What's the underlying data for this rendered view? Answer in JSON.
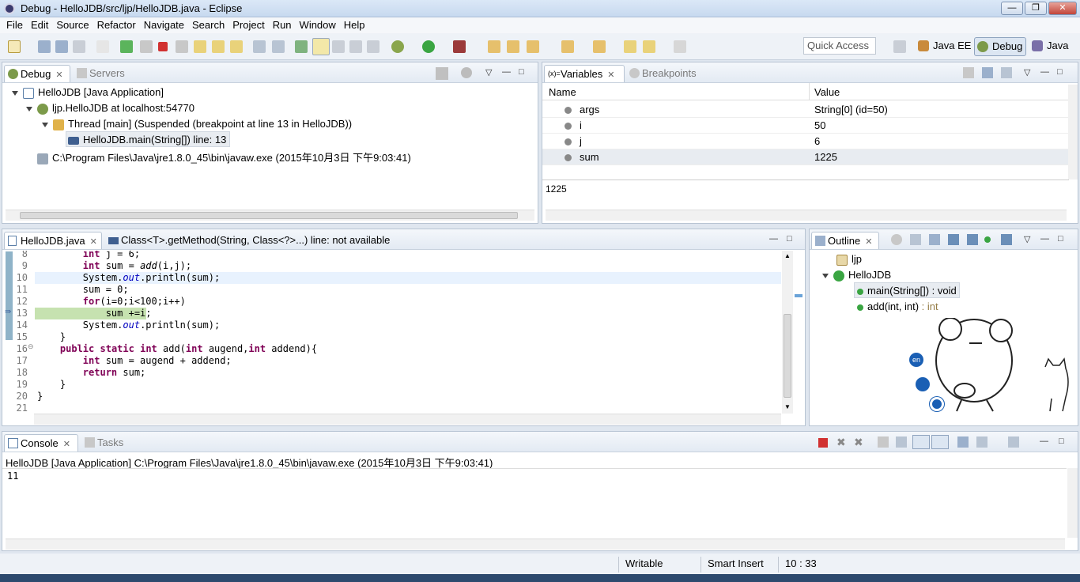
{
  "window": {
    "title": "Debug - HelloJDB/src/ljp/HelloJDB.java - Eclipse"
  },
  "menu": [
    "File",
    "Edit",
    "Source",
    "Refactor",
    "Navigate",
    "Search",
    "Project",
    "Run",
    "Window",
    "Help"
  ],
  "toolbar": {
    "quick_access": "Quick Access"
  },
  "perspectives": {
    "java_ee": "Java EE",
    "debug": "Debug",
    "java": "Java"
  },
  "debug_view": {
    "tab_debug": "Debug",
    "tab_servers": "Servers",
    "tree": {
      "app": "HelloJDB [Java Application]",
      "target": "ljp.HelloJDB at localhost:54770",
      "thread": "Thread [main] (Suspended (breakpoint at line 13 in HelloJDB))",
      "frame": "HelloJDB.main(String[]) line: 13",
      "process": "C:\\Program Files\\Java\\jre1.8.0_45\\bin\\javaw.exe (2015年10月3日 下午9:03:41)"
    }
  },
  "variables_view": {
    "tab_variables": "Variables",
    "tab_breakpoints": "Breakpoints",
    "col_name": "Name",
    "col_value": "Value",
    "rows": [
      {
        "name": "args",
        "value": "String[0]  (id=50)"
      },
      {
        "name": "i",
        "value": "50"
      },
      {
        "name": "j",
        "value": "6"
      },
      {
        "name": "sum",
        "value": "1225"
      }
    ],
    "detail": "1225"
  },
  "editor": {
    "tab_file": "HelloJDB.java",
    "tab_other": "Class<T>.getMethod(String, Class<?>...) line: not available",
    "lines": [
      {
        "n": "8",
        "t": "        int j = 6;"
      },
      {
        "n": "9",
        "t": "        int sum = add(i,j);"
      },
      {
        "n": "10",
        "t": "        System.out.println(sum);"
      },
      {
        "n": "11",
        "t": "        sum = 0;"
      },
      {
        "n": "12",
        "t": "        for(i=0;i<100;i++)"
      },
      {
        "n": "13",
        "t": "            sum +=i;"
      },
      {
        "n": "14",
        "t": "        System.out.println(sum);"
      },
      {
        "n": "15",
        "t": "    }"
      },
      {
        "n": "16",
        "t": "    public static int add(int augend,int addend){"
      },
      {
        "n": "17",
        "t": "        int sum = augend + addend;"
      },
      {
        "n": "18",
        "t": "        return sum;"
      },
      {
        "n": "19",
        "t": "    }"
      },
      {
        "n": "20",
        "t": "}"
      },
      {
        "n": "21",
        "t": ""
      }
    ]
  },
  "outline": {
    "tab": "Outline",
    "package": "ljp",
    "class": "HelloJDB",
    "main": "main(String[]) : void",
    "add_name": "add(int, int)",
    "add_type": " : int"
  },
  "console": {
    "tab_console": "Console",
    "tab_tasks": "Tasks",
    "header": "HelloJDB [Java Application] C:\\Program Files\\Java\\jre1.8.0_45\\bin\\javaw.exe (2015年10月3日 下午9:03:41)",
    "output": "11"
  },
  "status": {
    "writable": "Writable",
    "insert": "Smart Insert",
    "position": "10 : 33"
  },
  "mascot": {
    "badge": "en"
  }
}
